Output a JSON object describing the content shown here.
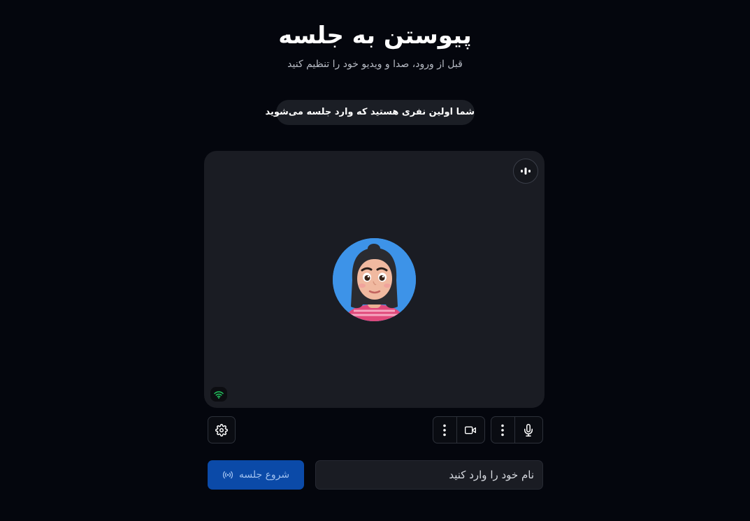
{
  "page": {
    "title": "پیوستن به جلسه",
    "subtitle": "قبل از ورود، صدا و ویدیو خود را تنظیم کنید"
  },
  "notice": {
    "text": "شما اولین نفری هستید که وارد جلسه می‌شوید"
  },
  "preview": {
    "audio_indicator_icon": "audio-level-icon",
    "avatar_icon": "user-avatar-3d",
    "connection_icon": "wifi-icon",
    "connection_color": "#22c55e"
  },
  "controls": {
    "microphone_icon": "microphone-icon",
    "microphone_options_icon": "more-vertical-icon",
    "camera_icon": "video-camera-icon",
    "camera_options_icon": "more-vertical-icon",
    "settings_icon": "gear-icon"
  },
  "join_form": {
    "name_placeholder": "نام خود را وارد کنید",
    "name_value": "",
    "start_label": "شروع جلسه",
    "start_icon": "broadcast-icon",
    "start_color": "#0b4aa8"
  }
}
